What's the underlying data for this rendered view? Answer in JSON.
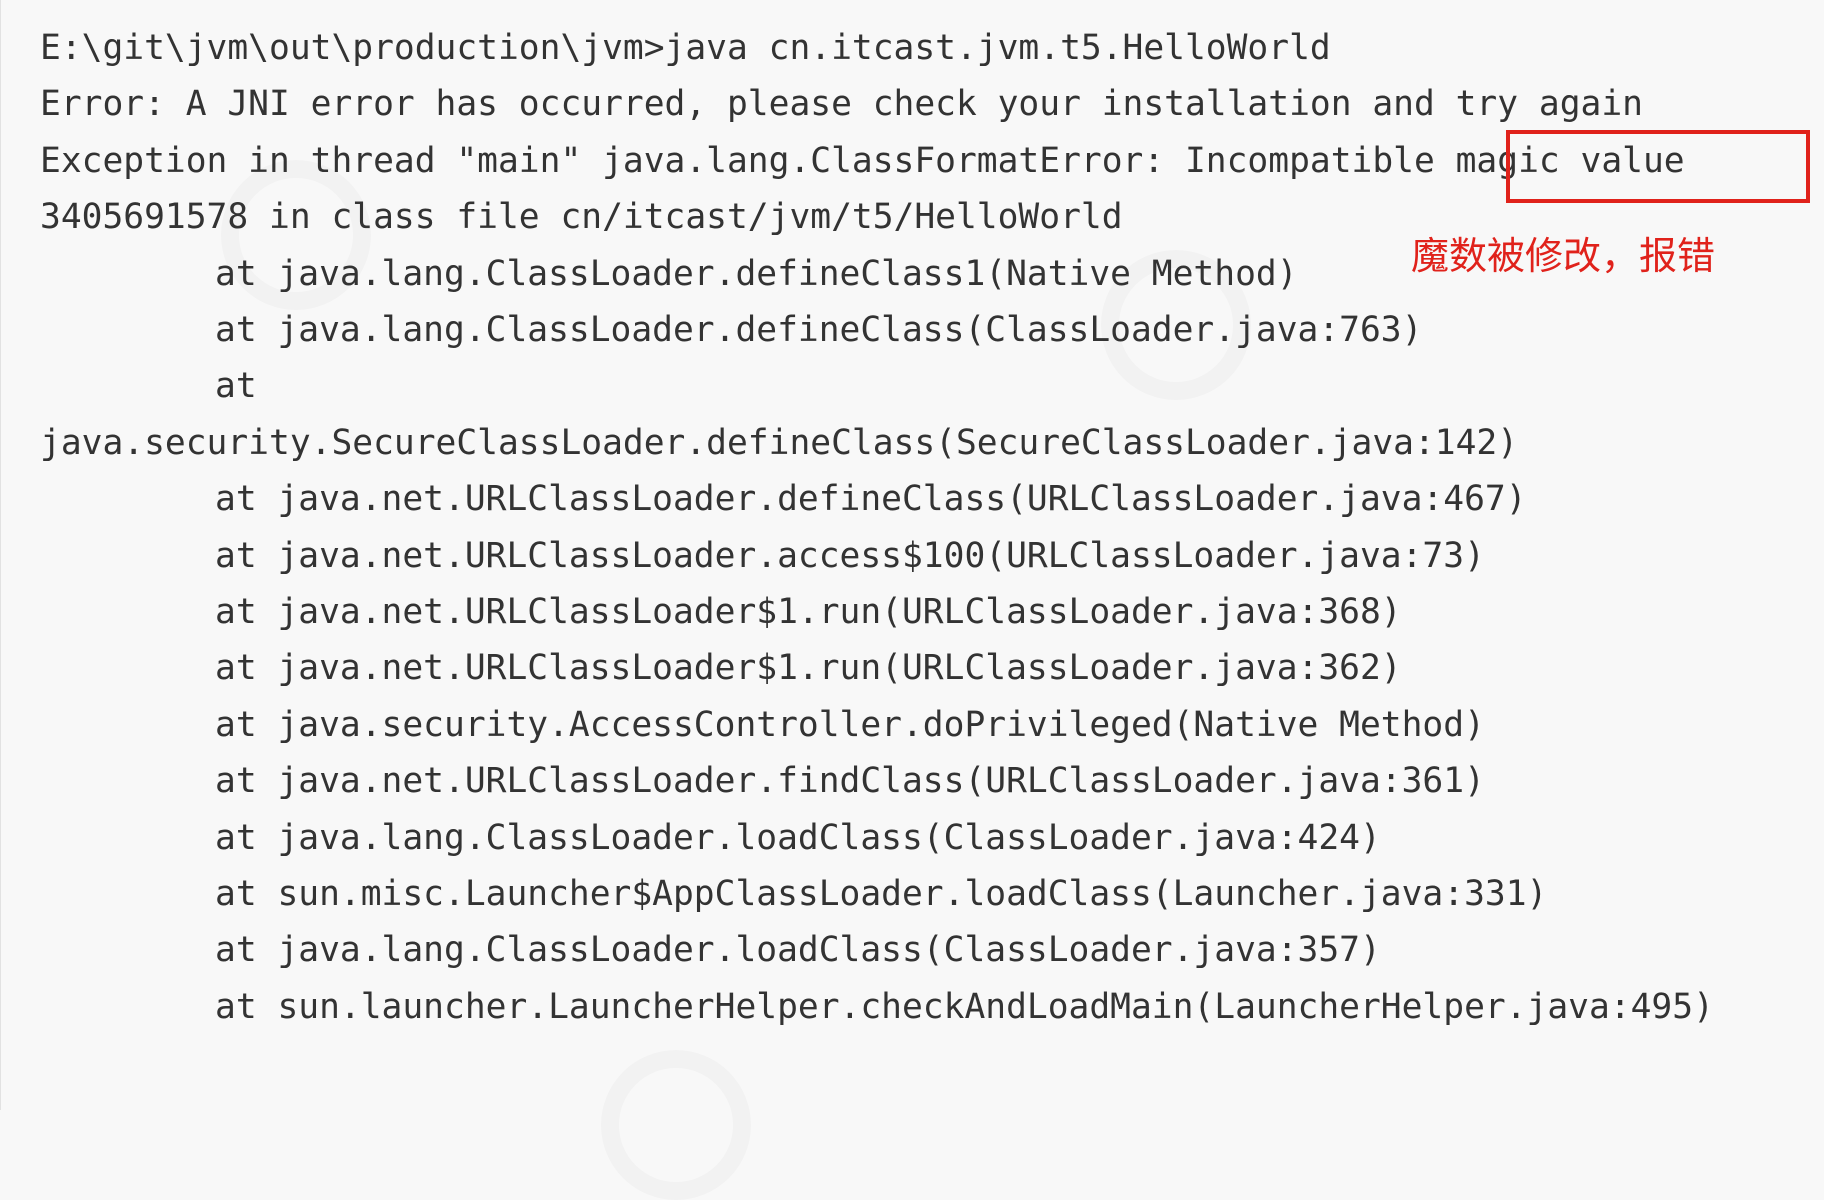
{
  "console": {
    "lines": [
      "E:\\git\\jvm\\out\\production\\jvm>java cn.itcast.jvm.t5.HelloWorld",
      "Error: A JNI error has occurred, please check your installation and try again",
      "Exception in thread \"main\" java.lang.ClassFormatError: Incompatible magic value",
      "3405691578 in class file cn/itcast/jvm/t5/HelloWorld",
      "at java.lang.ClassLoader.defineClass1(Native Method)",
      "at java.lang.ClassLoader.defineClass(ClassLoader.java:763)",
      "at",
      "java.security.SecureClassLoader.defineClass(SecureClassLoader.java:142)",
      "at java.net.URLClassLoader.defineClass(URLClassLoader.java:467)",
      "at java.net.URLClassLoader.access$100(URLClassLoader.java:73)",
      "at java.net.URLClassLoader$1.run(URLClassLoader.java:368)",
      "at java.net.URLClassLoader$1.run(URLClassLoader.java:362)",
      "at java.security.AccessController.doPrivileged(Native Method)",
      "at java.net.URLClassLoader.findClass(URLClassLoader.java:361)",
      "at java.lang.ClassLoader.loadClass(ClassLoader.java:424)",
      "at sun.misc.Launcher$AppClassLoader.loadClass(Launcher.java:331)",
      "at java.lang.ClassLoader.loadClass(ClassLoader.java:357)",
      "at sun.launcher.LauncherHelper.checkAndLoadMain(LauncherHelper.java:495)"
    ]
  },
  "annotation": {
    "text": "魔数被修改，报错",
    "color": "#e0221b"
  },
  "colors": {
    "background": "#f8f8f8",
    "text": "#333333",
    "highlight": "#e0221b"
  }
}
